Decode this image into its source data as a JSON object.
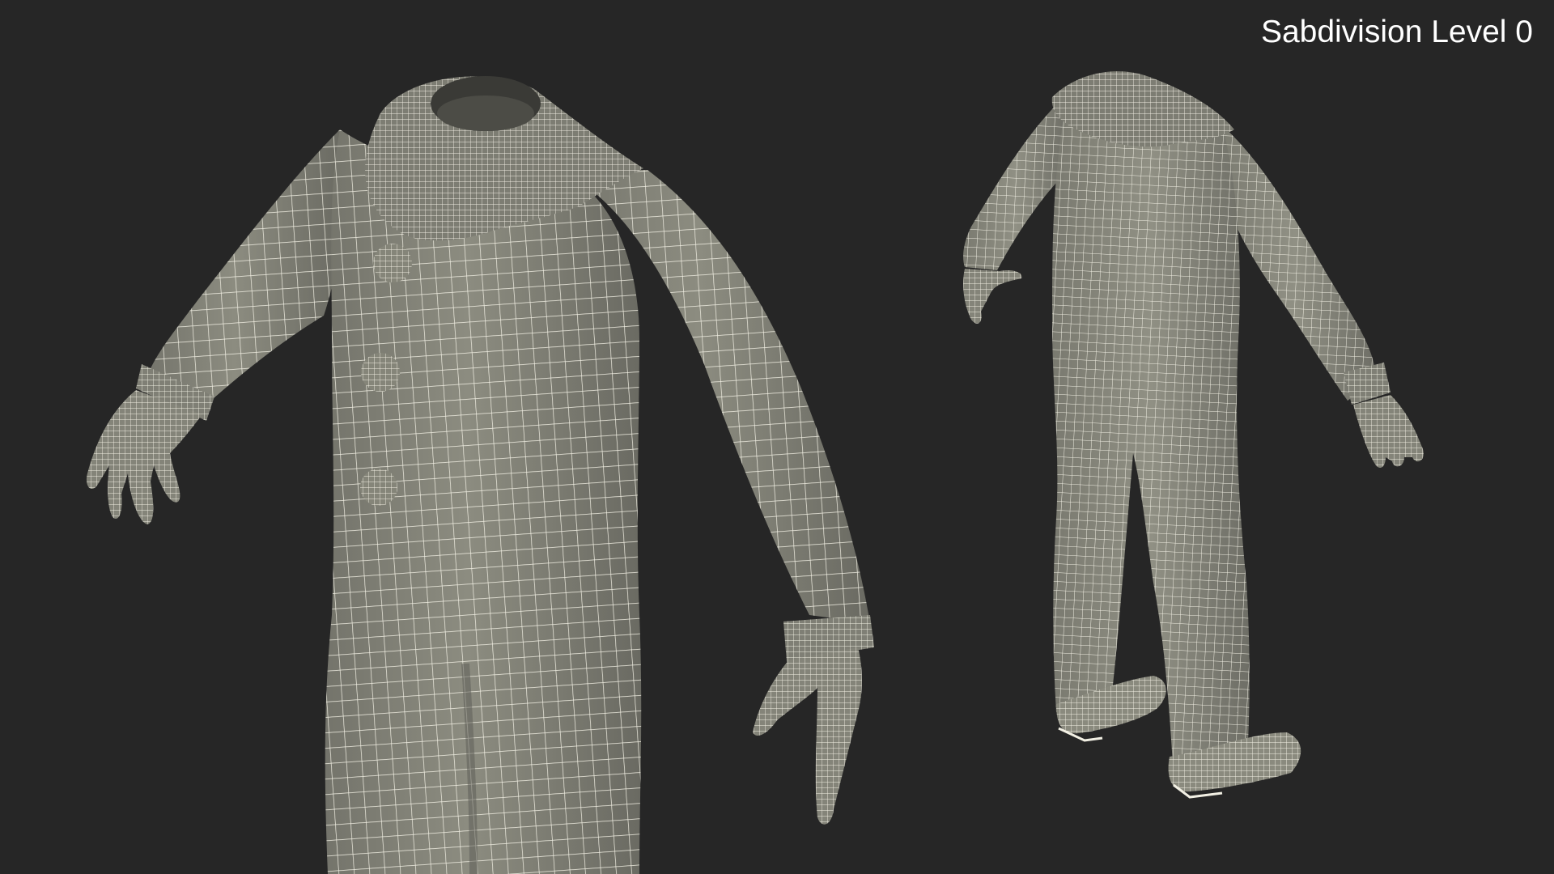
{
  "caption": "Sabdivision Level 0",
  "colors": {
    "background": "#262626",
    "mesh_fill": "#8a8a7e",
    "mesh_shadow": "#6f6f66",
    "wire": "#f2f0e4",
    "caption_text": "#ffffff"
  },
  "models": [
    {
      "view": "front three-quarter close-up",
      "parts": [
        "collar-ruffle",
        "torso",
        "left-arm",
        "right-arm",
        "left-hand",
        "right-hand",
        "pompom-buttons",
        "legs"
      ]
    },
    {
      "view": "rear three-quarter full body",
      "parts": [
        "collar-ruffle",
        "torso",
        "arms",
        "hands",
        "legs",
        "shoes"
      ]
    }
  ]
}
